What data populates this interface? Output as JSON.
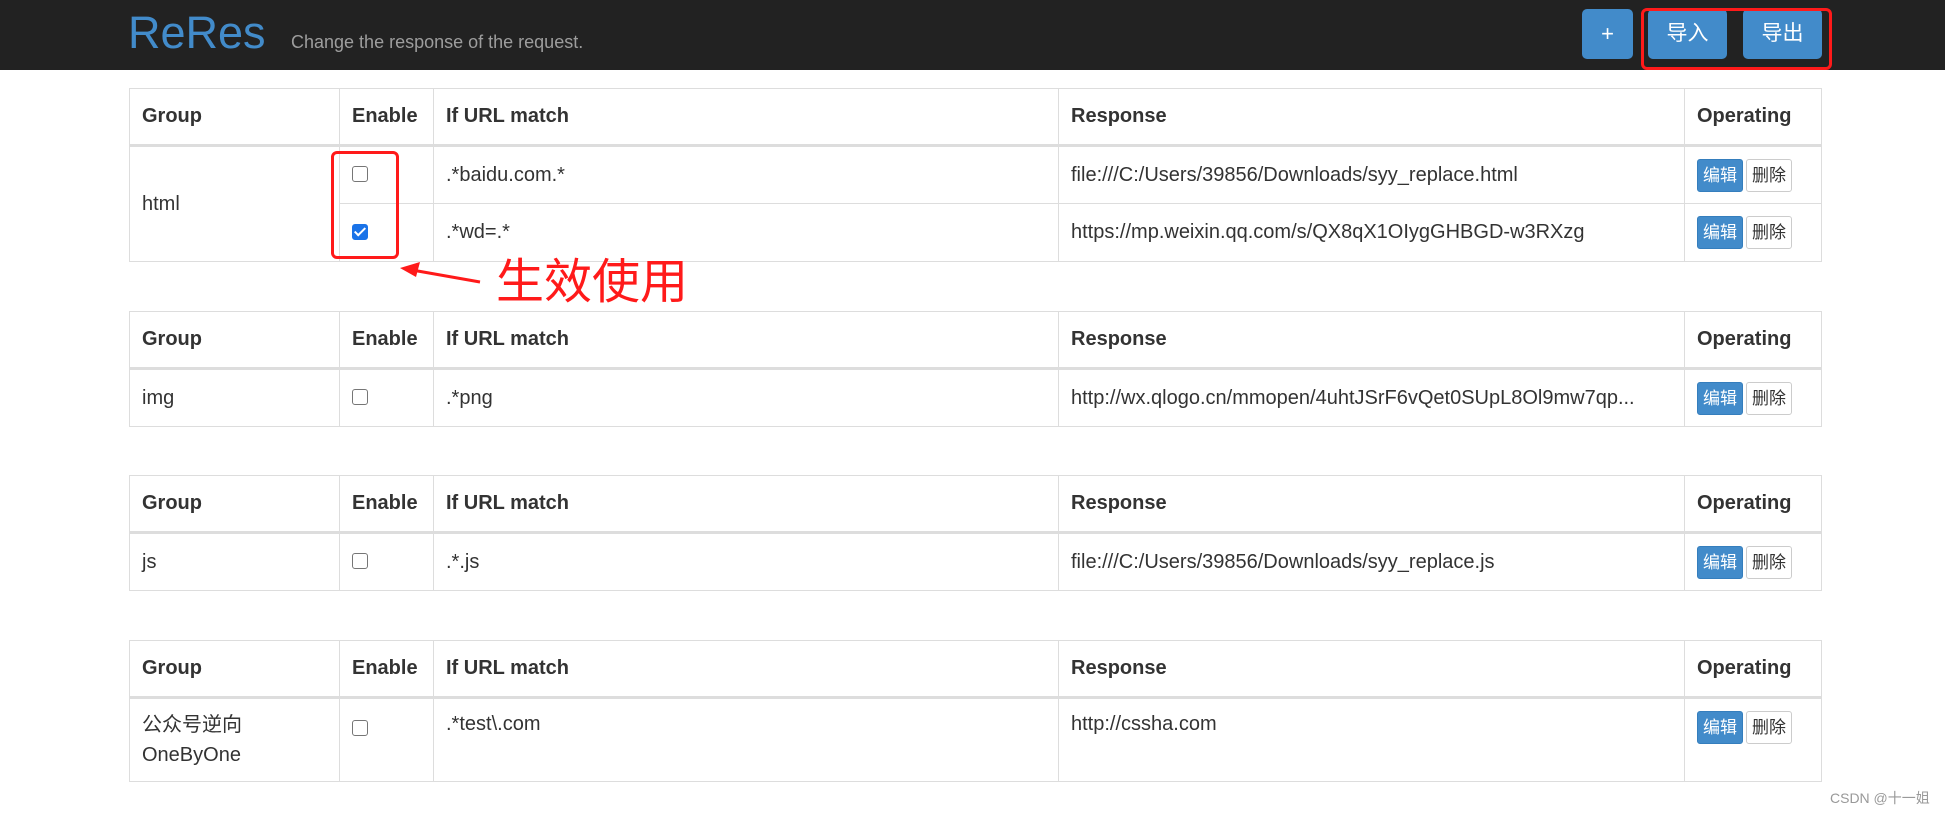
{
  "header": {
    "brand": "ReRes",
    "tagline": "Change the response of the request.",
    "add_label": "+",
    "import_label": "导入",
    "export_label": "导出"
  },
  "columns": {
    "group": "Group",
    "enable": "Enable",
    "match": "If URL match",
    "response": "Response",
    "operating": "Operating"
  },
  "buttons": {
    "edit": "编辑",
    "delete": "删除"
  },
  "groups": [
    {
      "name": "html",
      "rules": [
        {
          "enabled": false,
          "match": ".*baidu.com.*",
          "response": "file:///C:/Users/39856/Downloads/syy_replace.html"
        },
        {
          "enabled": true,
          "match": ".*wd=.*",
          "response": "https://mp.weixin.qq.com/s/QX8qX1OIygGHBGD-w3RXzg"
        }
      ]
    },
    {
      "name": "img",
      "rules": [
        {
          "enabled": false,
          "match": ".*png",
          "response": "http://wx.qlogo.cn/mmopen/4uhtJSrF6vQet0SUpL8Ol9mw7qp..."
        }
      ]
    },
    {
      "name": "js",
      "rules": [
        {
          "enabled": false,
          "match": ".*.js",
          "response": "file:///C:/Users/39856/Downloads/syy_replace.js"
        }
      ]
    },
    {
      "name_line1": "公众号逆向",
      "name_line2": "OneByOne",
      "rules": [
        {
          "enabled": false,
          "match": ".*test\\.com",
          "response": "http://cssha.com"
        }
      ]
    }
  ],
  "annotation": {
    "text": "生效使用",
    "color": "#ff1a1a"
  },
  "watermark": "CSDN @十一姐",
  "colors": {
    "navbar": "#222222",
    "brand": "#428bca",
    "primary_button": "#428bca",
    "highlight": "#ff1a1a",
    "checkbox_checked": "#1a73e8"
  }
}
